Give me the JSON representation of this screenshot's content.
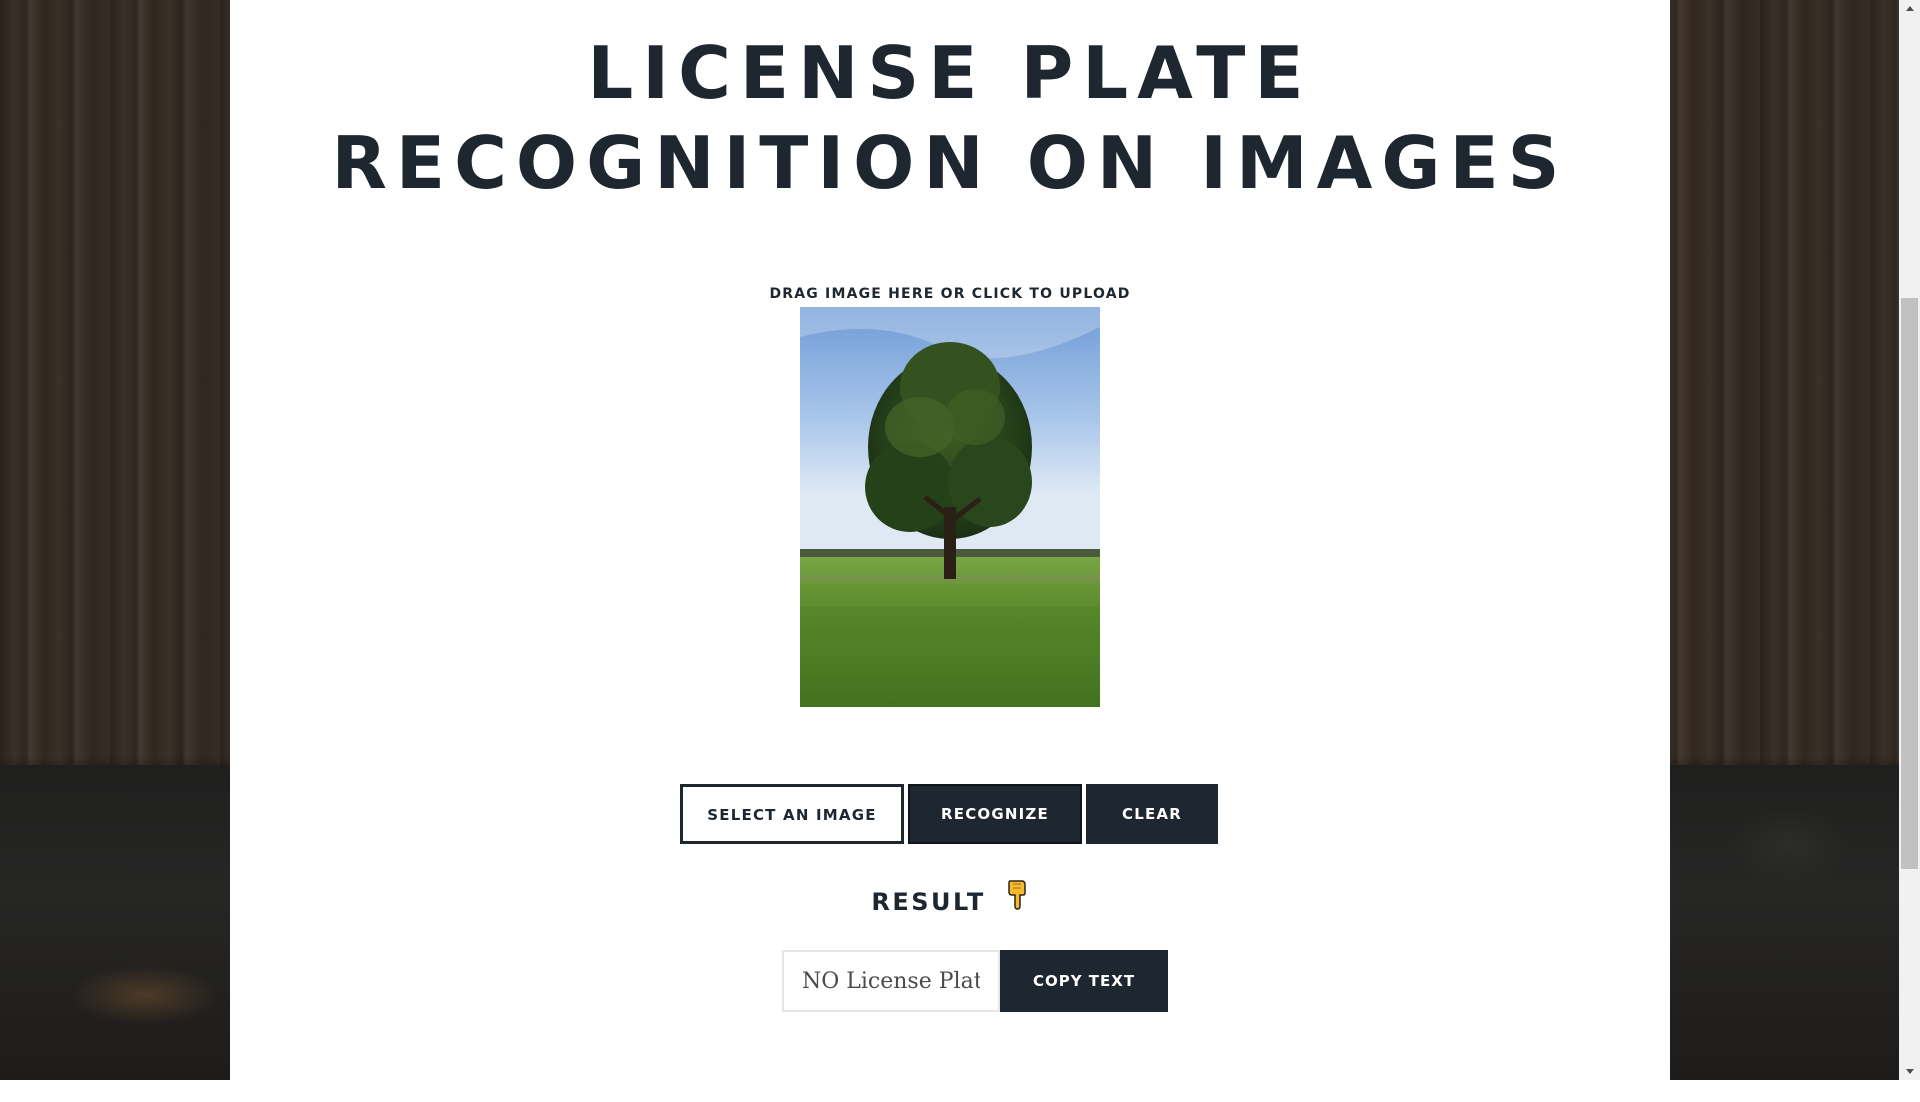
{
  "page": {
    "title_line1": "LICENSE PLATE",
    "title_line2": "RECOGNITION ON IMAGES",
    "drop_label": "DRAG IMAGE HERE OR CLICK TO UPLOAD"
  },
  "buttons": {
    "select_label": "SELECT AN IMAGE",
    "recognize_label": "RECOGNIZE",
    "clear_label": "CLEAR",
    "copy_label": "COPY TEXT"
  },
  "result": {
    "heading": "RESULT",
    "icon": "pointing-down-hand-icon",
    "output_value": "NO License Plate!"
  },
  "colors": {
    "primary_dark": "#1e2730",
    "panel_bg": "#ffffff"
  }
}
